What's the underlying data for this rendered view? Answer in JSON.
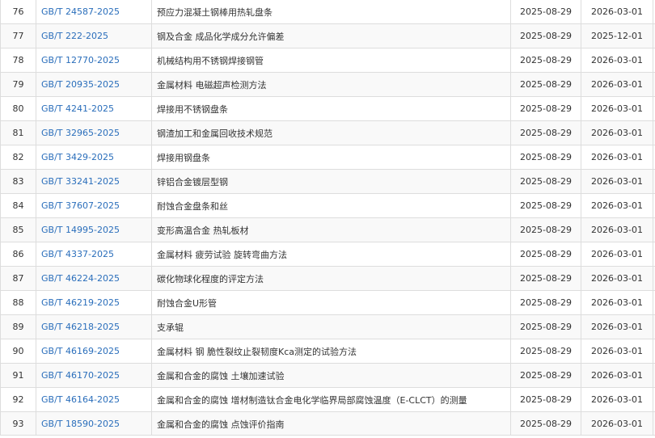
{
  "rows": [
    {
      "no": "76",
      "code": "GB/T 24587-2025",
      "name": "预应力混凝土钢棒用热轧盘条",
      "publish": "2025-08-29",
      "effective": "2026-03-01"
    },
    {
      "no": "77",
      "code": "GB/T 222-2025",
      "name": "钢及合金 成品化学成分允许偏差",
      "publish": "2025-08-29",
      "effective": "2025-12-01"
    },
    {
      "no": "78",
      "code": "GB/T 12770-2025",
      "name": "机械结构用不锈钢焊接钢管",
      "publish": "2025-08-29",
      "effective": "2026-03-01"
    },
    {
      "no": "79",
      "code": "GB/T 20935-2025",
      "name": "金属材料 电磁超声检测方法",
      "publish": "2025-08-29",
      "effective": "2026-03-01"
    },
    {
      "no": "80",
      "code": "GB/T 4241-2025",
      "name": "焊接用不锈钢盘条",
      "publish": "2025-08-29",
      "effective": "2026-03-01"
    },
    {
      "no": "81",
      "code": "GB/T 32965-2025",
      "name": "钢渣加工和金属回收技术规范",
      "publish": "2025-08-29",
      "effective": "2026-03-01"
    },
    {
      "no": "82",
      "code": "GB/T 3429-2025",
      "name": "焊接用钢盘条",
      "publish": "2025-08-29",
      "effective": "2026-03-01"
    },
    {
      "no": "83",
      "code": "GB/T 33241-2025",
      "name": "锌铝合金镀层型钢",
      "publish": "2025-08-29",
      "effective": "2026-03-01"
    },
    {
      "no": "84",
      "code": "GB/T 37607-2025",
      "name": "耐蚀合金盘条和丝",
      "publish": "2025-08-29",
      "effective": "2026-03-01"
    },
    {
      "no": "85",
      "code": "GB/T 14995-2025",
      "name": "变形高温合金 热轧板材",
      "publish": "2025-08-29",
      "effective": "2026-03-01"
    },
    {
      "no": "86",
      "code": "GB/T 4337-2025",
      "name": "金属材料 疲劳试验 旋转弯曲方法",
      "publish": "2025-08-29",
      "effective": "2026-03-01"
    },
    {
      "no": "87",
      "code": "GB/T 46224-2025",
      "name": "碳化物球化程度的评定方法",
      "publish": "2025-08-29",
      "effective": "2026-03-01"
    },
    {
      "no": "88",
      "code": "GB/T 46219-2025",
      "name": "耐蚀合金U形管",
      "publish": "2025-08-29",
      "effective": "2026-03-01"
    },
    {
      "no": "89",
      "code": "GB/T 46218-2025",
      "name": "支承辊",
      "publish": "2025-08-29",
      "effective": "2026-03-01"
    },
    {
      "no": "90",
      "code": "GB/T 46169-2025",
      "name": "金属材料 钢 脆性裂纹止裂韧度Kca测定的试验方法",
      "publish": "2025-08-29",
      "effective": "2026-03-01"
    },
    {
      "no": "91",
      "code": "GB/T 46170-2025",
      "name": "金属和合金的腐蚀 土壤加速试验",
      "publish": "2025-08-29",
      "effective": "2026-03-01"
    },
    {
      "no": "92",
      "code": "GB/T 46164-2025",
      "name": "金属和合金的腐蚀 增材制造钛合金电化学临界局部腐蚀温度（E-CLCT）的测量",
      "publish": "2025-08-29",
      "effective": "2026-03-01"
    },
    {
      "no": "93",
      "code": "GB/T 18590-2025",
      "name": "金属和合金的腐蚀 点蚀评价指南",
      "publish": "2025-08-29",
      "effective": "2026-03-01"
    }
  ]
}
